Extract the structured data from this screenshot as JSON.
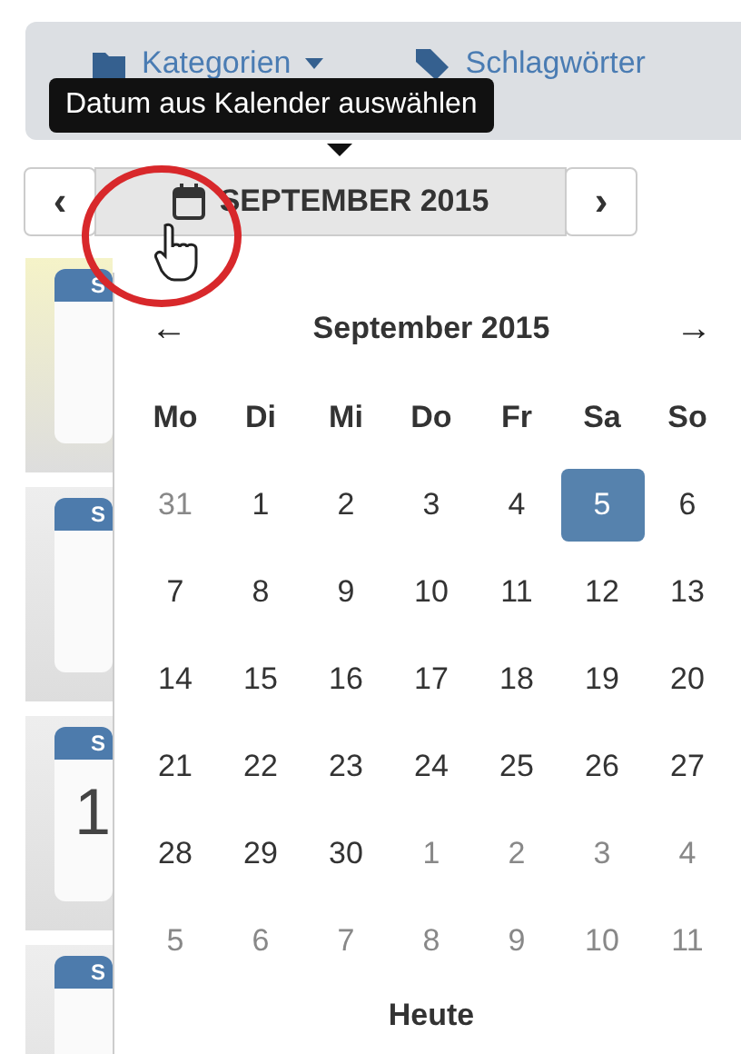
{
  "tabs": [
    {
      "label": "Kategorien",
      "caret": true
    },
    {
      "label": "Schlagwörter",
      "caret": false
    }
  ],
  "tooltip": "Datum aus Kalender auswählen",
  "month_switcher": {
    "prev": "‹",
    "label": "SEPTEMBER 2015",
    "next": "›"
  },
  "cards": [
    {
      "header": "S",
      "highlighted": true
    },
    {
      "header": "S",
      "highlighted": false
    },
    {
      "header": "S",
      "highlighted": false,
      "value": "1"
    },
    {
      "header": "S",
      "highlighted": false
    }
  ],
  "calendar": {
    "title": "September 2015",
    "prev": "←",
    "next": "→",
    "weekdays": [
      "Mo",
      "Di",
      "Mi",
      "Do",
      "Fr",
      "Sa",
      "So"
    ],
    "weeks": [
      [
        {
          "label": "31",
          "muted": true,
          "selected": false
        },
        {
          "label": "1",
          "muted": false,
          "selected": false
        },
        {
          "label": "2",
          "muted": false,
          "selected": false
        },
        {
          "label": "3",
          "muted": false,
          "selected": false
        },
        {
          "label": "4",
          "muted": false,
          "selected": false
        },
        {
          "label": "5",
          "muted": false,
          "selected": true
        },
        {
          "label": "6",
          "muted": false,
          "selected": false
        }
      ],
      [
        {
          "label": "7",
          "muted": false,
          "selected": false
        },
        {
          "label": "8",
          "muted": false,
          "selected": false
        },
        {
          "label": "9",
          "muted": false,
          "selected": false
        },
        {
          "label": "10",
          "muted": false,
          "selected": false
        },
        {
          "label": "11",
          "muted": false,
          "selected": false
        },
        {
          "label": "12",
          "muted": false,
          "selected": false
        },
        {
          "label": "13",
          "muted": false,
          "selected": false
        }
      ],
      [
        {
          "label": "14",
          "muted": false,
          "selected": false
        },
        {
          "label": "15",
          "muted": false,
          "selected": false
        },
        {
          "label": "16",
          "muted": false,
          "selected": false
        },
        {
          "label": "17",
          "muted": false,
          "selected": false
        },
        {
          "label": "18",
          "muted": false,
          "selected": false
        },
        {
          "label": "19",
          "muted": false,
          "selected": false
        },
        {
          "label": "20",
          "muted": false,
          "selected": false
        }
      ],
      [
        {
          "label": "21",
          "muted": false,
          "selected": false
        },
        {
          "label": "22",
          "muted": false,
          "selected": false
        },
        {
          "label": "23",
          "muted": false,
          "selected": false
        },
        {
          "label": "24",
          "muted": false,
          "selected": false
        },
        {
          "label": "25",
          "muted": false,
          "selected": false
        },
        {
          "label": "26",
          "muted": false,
          "selected": false
        },
        {
          "label": "27",
          "muted": false,
          "selected": false
        }
      ],
      [
        {
          "label": "28",
          "muted": false,
          "selected": false
        },
        {
          "label": "29",
          "muted": false,
          "selected": false
        },
        {
          "label": "30",
          "muted": false,
          "selected": false
        },
        {
          "label": "1",
          "muted": true,
          "selected": false
        },
        {
          "label": "2",
          "muted": true,
          "selected": false
        },
        {
          "label": "3",
          "muted": true,
          "selected": false
        },
        {
          "label": "4",
          "muted": true,
          "selected": false
        }
      ],
      [
        {
          "label": "5",
          "muted": true,
          "selected": false
        },
        {
          "label": "6",
          "muted": true,
          "selected": false
        },
        {
          "label": "7",
          "muted": true,
          "selected": false
        },
        {
          "label": "8",
          "muted": true,
          "selected": false
        },
        {
          "label": "9",
          "muted": true,
          "selected": false
        },
        {
          "label": "10",
          "muted": true,
          "selected": false
        },
        {
          "label": "11",
          "muted": true,
          "selected": false
        }
      ]
    ],
    "today": "Heute"
  }
}
